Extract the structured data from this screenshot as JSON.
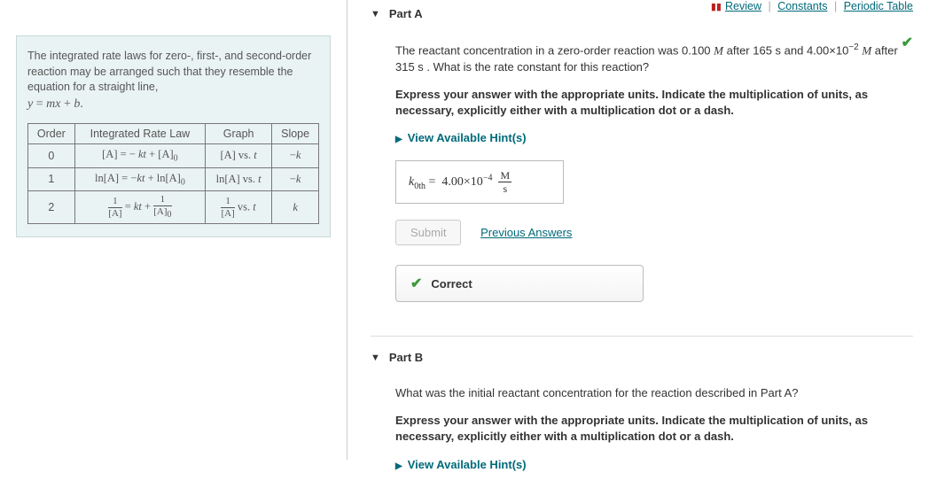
{
  "top_links": {
    "review": "Review",
    "constants": "Constants",
    "periodic": "Periodic Table"
  },
  "info": {
    "intro": "The integrated rate laws for zero-, first-, and second-order reaction may be arranged such that they resemble the equation for a straight line,",
    "headers": {
      "order": "Order",
      "law": "Integrated Rate Law",
      "graph": "Graph",
      "slope": "Slope"
    },
    "rows": {
      "r0": {
        "order": "0"
      },
      "r1": {
        "order": "1"
      },
      "r2": {
        "order": "2"
      }
    }
  },
  "partA": {
    "title": "Part A",
    "q_before": "The reactant concentration in a zero-order reaction was 0.100 ",
    "q_mid1": " after 165 s and 4.00×10",
    "q_mid2": " ",
    "q_after": " after 315 s . What is the rate constant for this reaction?",
    "instr": "Express your answer with the appropriate units. Indicate the multiplication of units, as necessary, explicitly either with a multiplication dot or a dash.",
    "hint": "View Available Hint(s)",
    "answer_value": "4.00×10",
    "answer_exp": "−4",
    "submit": "Submit",
    "prev": "Previous Answers",
    "correct": "Correct"
  },
  "partB": {
    "title": "Part B",
    "q": "What was the initial reactant concentration for the reaction described in Part A?",
    "instr": "Express your answer with the appropriate units. Indicate the multiplication of units, as necessary, explicitly either with a multiplication dot or a dash.",
    "hint": "View Available Hint(s)"
  }
}
